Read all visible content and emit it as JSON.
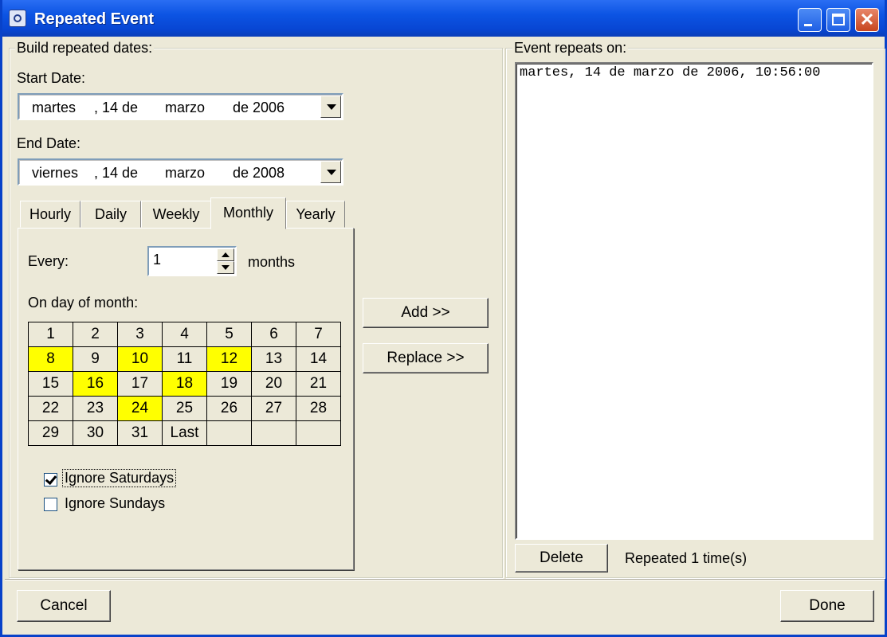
{
  "window": {
    "title": "Repeated Event"
  },
  "build_group": {
    "label": "Build repeated dates:",
    "start_date_label": "Start Date:",
    "start_date": {
      "weekday": "martes",
      "day": ", 14 de",
      "month": "marzo",
      "year": "de 2006"
    },
    "end_date_label": "End Date:",
    "end_date": {
      "weekday": "viernes",
      "day": ", 14 de",
      "month": "marzo",
      "year": "de 2008"
    }
  },
  "tabs": [
    {
      "label": "Hourly"
    },
    {
      "label": "Daily"
    },
    {
      "label": "Weekly"
    },
    {
      "label": "Monthly",
      "active": true
    },
    {
      "label": "Yearly"
    }
  ],
  "monthly": {
    "every_label": "Every:",
    "every_value": "1",
    "every_unit": "months",
    "day_of_month_label": "On day of month:",
    "days": [
      [
        "1",
        "2",
        "3",
        "4",
        "5",
        "6",
        "7"
      ],
      [
        "8",
        "9",
        "10",
        "11",
        "12",
        "13",
        "14"
      ],
      [
        "15",
        "16",
        "17",
        "18",
        "19",
        "20",
        "21"
      ],
      [
        "22",
        "23",
        "24",
        "25",
        "26",
        "27",
        "28"
      ],
      [
        "29",
        "30",
        "31",
        "Last",
        "",
        "",
        ""
      ]
    ],
    "selected_days": [
      "8",
      "10",
      "12",
      "16",
      "18",
      "24"
    ],
    "highlight_color": "#ffff00",
    "ignore_saturdays": {
      "label": "Ignore Saturdays",
      "checked": true
    },
    "ignore_sundays": {
      "label": "Ignore Sundays",
      "checked": false
    }
  },
  "actions": {
    "add_label": "Add >>",
    "replace_label": "Replace >>"
  },
  "repeats_group": {
    "label": "Event repeats on:",
    "items": [
      "martes, 14 de marzo de 2006, 10:56:00"
    ],
    "delete_label": "Delete",
    "count_text": "Repeated 1 time(s)"
  },
  "footer": {
    "cancel_label": "Cancel",
    "done_label": "Done"
  },
  "colors": {
    "titlebar": "#0c54e3",
    "window_bg": "#ece9d8"
  }
}
